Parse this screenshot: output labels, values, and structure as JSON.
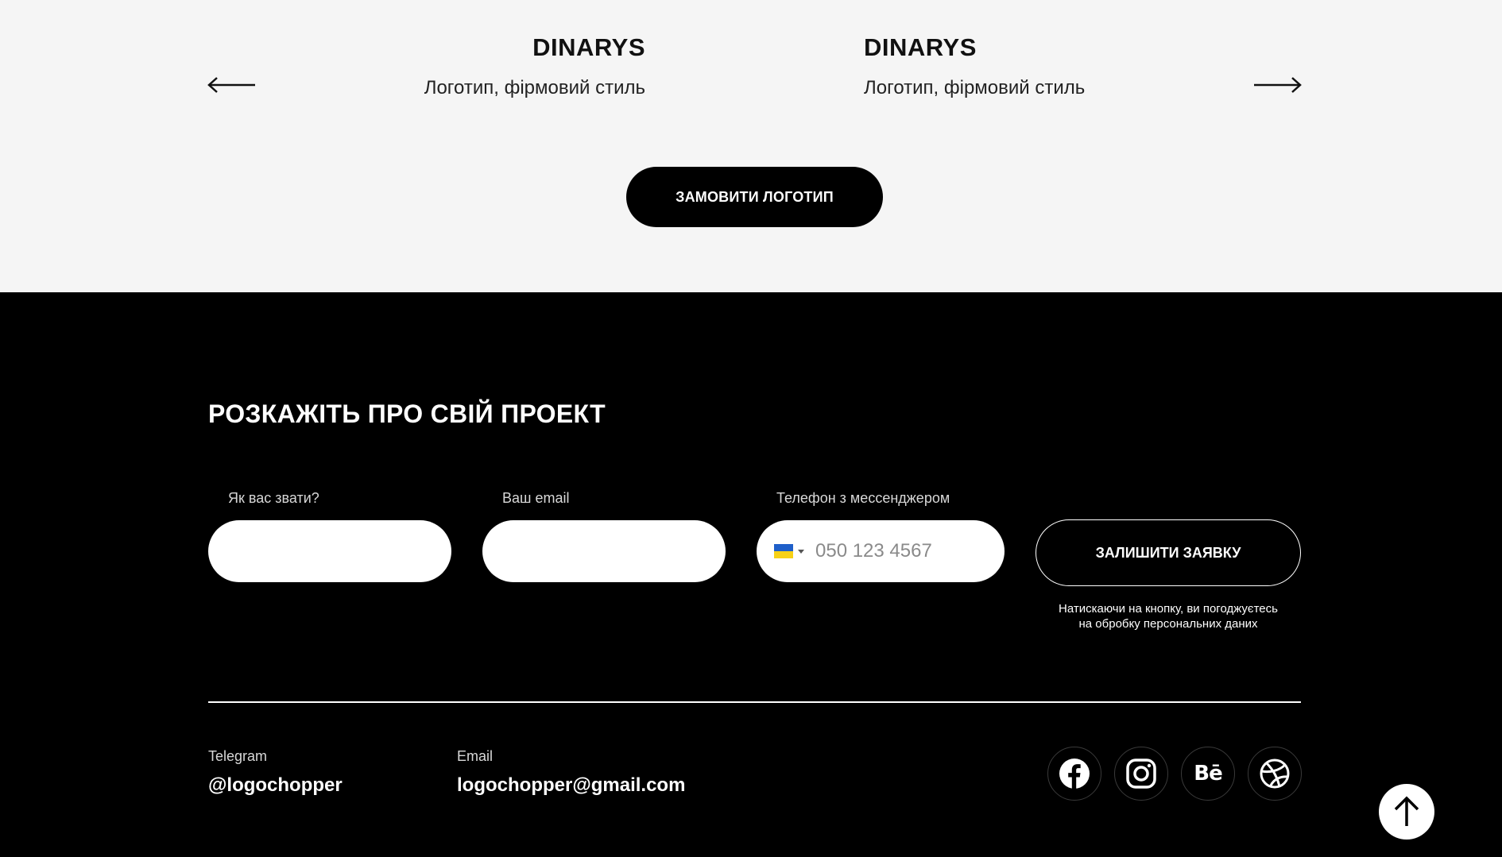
{
  "portfolio": {
    "cards": [
      {
        "title": "DINARYS",
        "subtitle": "Логотип, фірмовий стиль"
      },
      {
        "title": "DINARYS",
        "subtitle": "Логотип, фірмовий стиль"
      }
    ],
    "order_button": "ЗАМОВИТИ ЛОГОТИП"
  },
  "form": {
    "heading": "РОЗКАЖІТЬ ПРО СВІЙ ПРОЕКТ",
    "name_label": "Як вас звати?",
    "email_label": "Ваш email",
    "phone_label": "Телефон з мессенджером",
    "phone_placeholder": "050 123 4567",
    "submit_label": "ЗАЛИШИТИ ЗАЯВКУ",
    "consent_line1": "Натискаючи на кнопку, ви погоджуєтесь",
    "consent_line2": "на обробку персональних даних"
  },
  "contacts": {
    "telegram_label": "Telegram",
    "telegram_value": "@logochopper",
    "email_label": "Email",
    "email_value": "logochopper@gmail.com"
  },
  "social": {
    "icons": [
      "facebook-icon",
      "instagram-icon",
      "behance-icon",
      "dribbble-icon"
    ],
    "behance_text": "Bē"
  },
  "colors": {
    "dark_bg": "#000000",
    "light_bg": "#f5f5f5",
    "flag_blue": "#1f5fc9",
    "flag_yellow": "#f7d117"
  }
}
